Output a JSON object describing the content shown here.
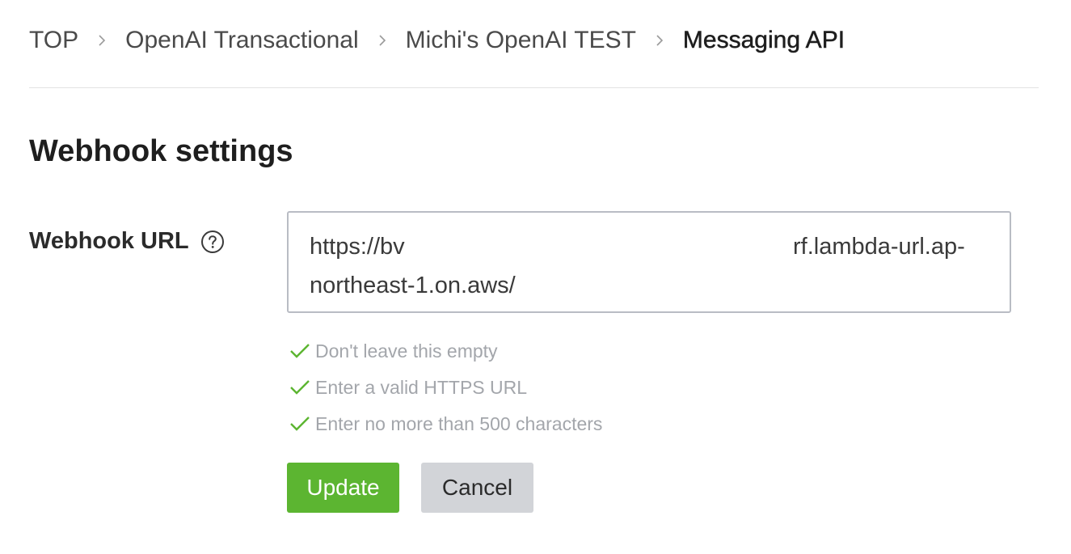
{
  "breadcrumb": {
    "items": [
      "TOP",
      "OpenAI Transactional",
      "Michi's OpenAI TEST"
    ],
    "current": "Messaging API"
  },
  "section": {
    "title": "Webhook settings"
  },
  "webhook": {
    "label": "Webhook URL",
    "help_icon": "question-circle-icon",
    "url_line1_start": "https://bv",
    "url_line1_end": "rf.lambda-url.ap-",
    "url_line2": "northeast-1.on.aws/"
  },
  "validations": [
    {
      "text": "Don't leave this empty",
      "icon": "check-icon"
    },
    {
      "text": "Enter a valid HTTPS URL",
      "icon": "check-icon"
    },
    {
      "text": "Enter no more than 500 characters",
      "icon": "check-icon"
    }
  ],
  "buttons": {
    "update_label": "Update",
    "cancel_label": "Cancel"
  },
  "colors": {
    "primary_green": "#5cb531",
    "check_green": "#5cb531",
    "cancel_gray": "#d2d4d8",
    "hint_gray": "#a3a6ab"
  }
}
